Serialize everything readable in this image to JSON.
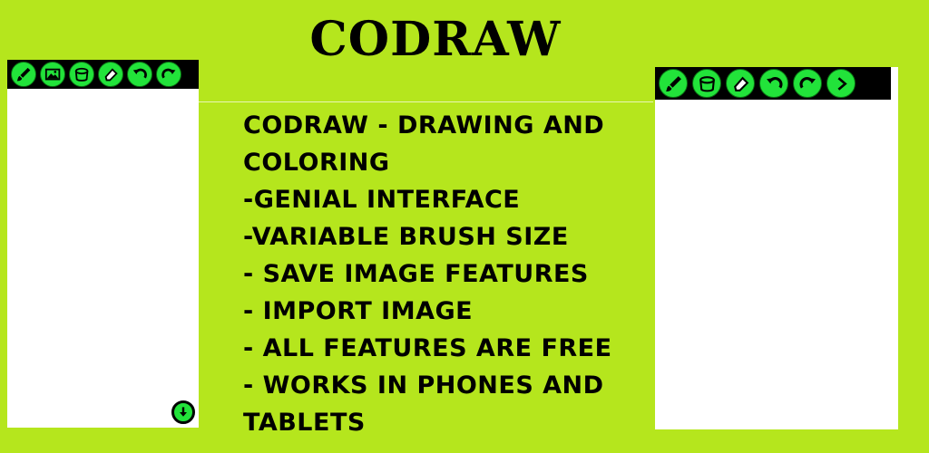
{
  "title": "CODRAW",
  "features": [
    "CODRAW - DRAWING AND",
    "COLORING",
    "-GENIAL INTERFACE",
    "-VARIABLE BRUSH SIZE",
    "- SAVE IMAGE FEATURES",
    "- IMPORT IMAGE",
    "- ALL FEATURES ARE FREE",
    "- WORKS IN PHONES AND",
    "TABLETS"
  ],
  "left_toolbar": [
    "brush-icon",
    "image-icon",
    "paint-bucket-icon",
    "eraser-icon",
    "undo-icon",
    "redo-icon"
  ],
  "right_toolbar": [
    "brush-icon",
    "paint-bucket-icon",
    "eraser-icon",
    "undo-icon",
    "redo-icon",
    "next-icon"
  ],
  "colors": {
    "background": "#b5e61d",
    "tool_green": "#22e33a",
    "toolbar_black": "#000000"
  }
}
